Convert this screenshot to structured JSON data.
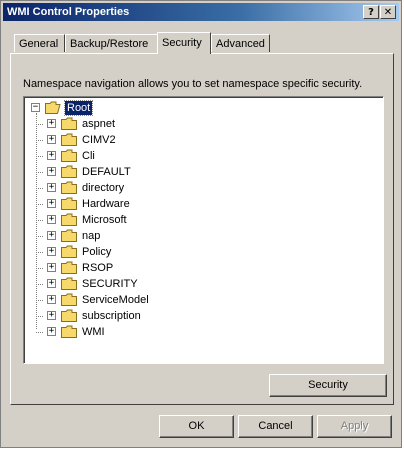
{
  "window": {
    "title": "WMI Control Properties",
    "help_glyph": "?",
    "close_glyph": "✕"
  },
  "tabs": [
    {
      "label": "General"
    },
    {
      "label": "Backup/Restore"
    },
    {
      "label": "Security",
      "active": true
    },
    {
      "label": "Advanced"
    }
  ],
  "security_tab": {
    "description": "Namespace navigation allows you to set namespace specific security.",
    "tree": {
      "root": {
        "label": "Root",
        "expanded": true,
        "selected": true
      },
      "children": [
        {
          "label": "aspnet"
        },
        {
          "label": "CIMV2"
        },
        {
          "label": "Cli"
        },
        {
          "label": "DEFAULT"
        },
        {
          "label": "directory"
        },
        {
          "label": "Hardware"
        },
        {
          "label": "Microsoft"
        },
        {
          "label": "nap"
        },
        {
          "label": "Policy"
        },
        {
          "label": "RSOP"
        },
        {
          "label": "SECURITY"
        },
        {
          "label": "ServiceModel"
        },
        {
          "label": "subscription"
        },
        {
          "label": "WMI"
        }
      ]
    },
    "security_button": "Security"
  },
  "footer": {
    "ok": "OK",
    "cancel": "Cancel",
    "apply": "Apply",
    "apply_enabled": false
  },
  "colors": {
    "title_bar": "#0a246a",
    "dialog_bg": "#d4d0c8",
    "selection": "#0a246a",
    "folder": "#f6d86b"
  }
}
